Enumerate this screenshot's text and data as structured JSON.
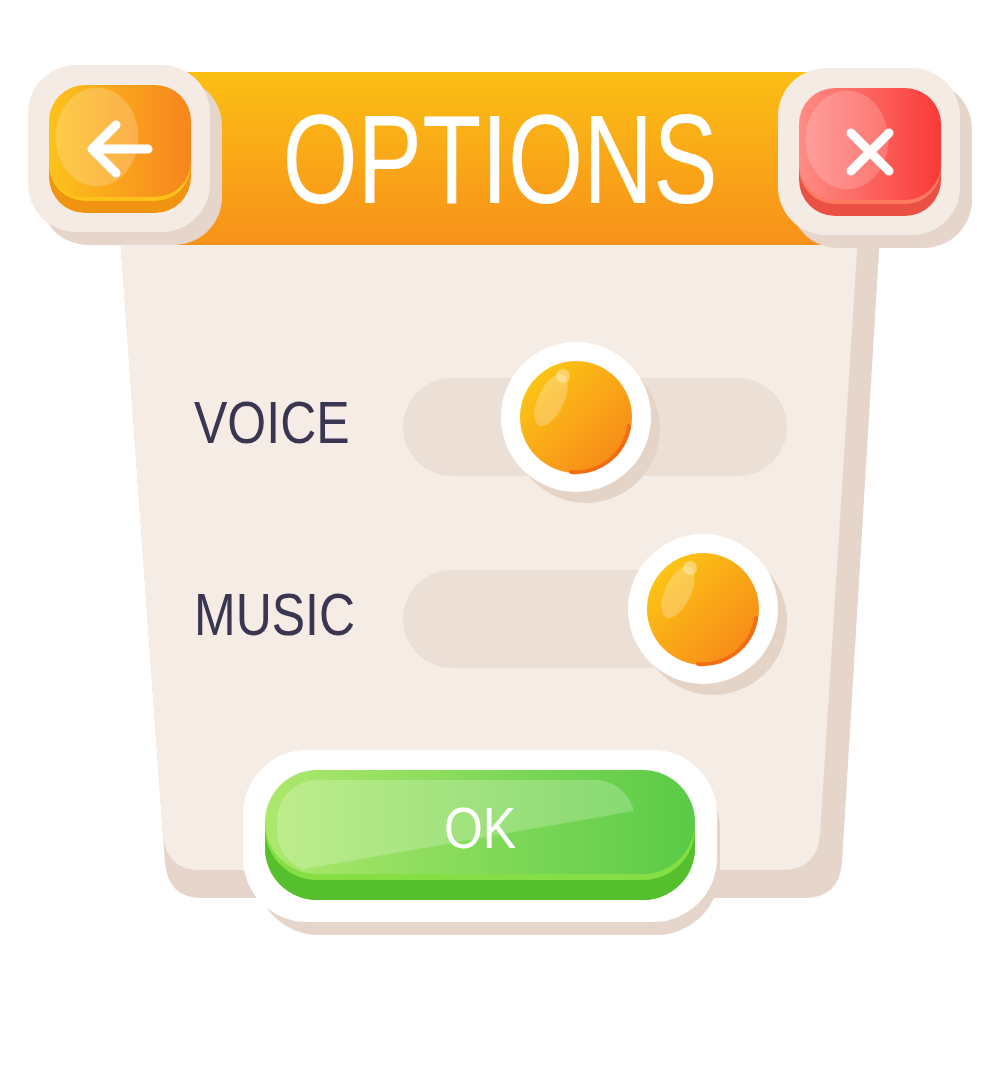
{
  "title": "OPTIONS",
  "settings": [
    {
      "label": "VOICE",
      "level": 0.45
    },
    {
      "label": "MUSIC",
      "level": 0.78
    }
  ],
  "ok_button": {
    "label": "OK"
  }
}
